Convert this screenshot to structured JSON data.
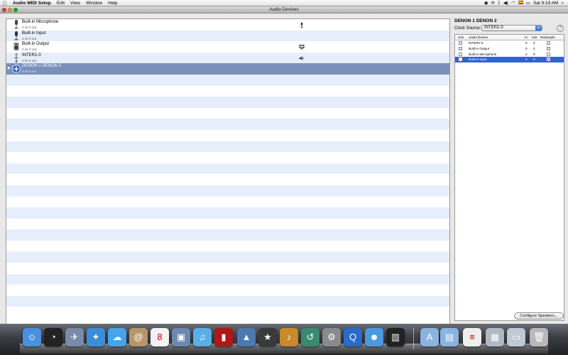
{
  "menubar": {
    "apple": "",
    "items": [
      "Audio MIDI Setup",
      "Edit",
      "View",
      "Window",
      "Help"
    ],
    "clock": "Sat 9:19 AM"
  },
  "window": {
    "title": "Audio Devices"
  },
  "devices": [
    {
      "name": "Built-in Microphone",
      "io": "2 in/ 0 out",
      "icon": "microphone-device-icon",
      "status": "microphone-status-icon"
    },
    {
      "name": "Built-in Input",
      "io": "2 in/ 0 out",
      "icon": "input-device-icon",
      "status": ""
    },
    {
      "name": "Built-in Output",
      "io": "0 in/ 2 out",
      "icon": "speaker-device-icon",
      "status": "display-status-icon"
    },
    {
      "name": "INTER1-0",
      "io": "0 in/ 2 out",
      "icon": "usb-device-icon",
      "status": "volume-status-icon"
    },
    {
      "name": "DENON 1 DENON 2",
      "io": "0 in/ 0 out",
      "icon": "aggregate-device-icon",
      "status": "",
      "selected": true
    }
  ],
  "list_footer": {
    "add": "+",
    "remove": "−",
    "gear": "⚙▾"
  },
  "panel": {
    "title": "DENON 1 DENON 2",
    "clock_label": "Clock Source:",
    "clock_value": "INTER1-0",
    "help": "?",
    "columns": {
      "use": "Use",
      "device": "Audio Device",
      "in": "In",
      "out": "Out",
      "resample": "Resample"
    },
    "rows": [
      {
        "device": "INTER1-0",
        "in": "0",
        "out": "2",
        "use": true,
        "resample": true
      },
      {
        "device": "Built-in Output",
        "in": "0",
        "out": "2",
        "use": true,
        "resample": true
      },
      {
        "device": "Built-in Microphone",
        "in": "2",
        "out": "0",
        "use": false,
        "resample": false
      },
      {
        "device": "Built-in Input",
        "in": "2",
        "out": "0",
        "use": false,
        "resample": false,
        "selected": true
      }
    ],
    "configure_button": "Configure Speakers..."
  },
  "dock": {
    "apps": [
      "finder-icon",
      "dashboard-icon",
      "mail-icon",
      "safari-icon",
      "ichat-icon",
      "address-book-icon",
      "ical-icon",
      "preview-icon",
      "itunes-icon",
      "photo-booth-icon",
      "iphoto-icon",
      "imovie-icon",
      "garageband-icon",
      "time-machine-icon",
      "system-preferences-icon",
      "quicktime-icon",
      "users-icon",
      "midi-keyboard-icon",
      "applications-folder-icon",
      "documents-folder-icon",
      "document-icon",
      "downloads-icon",
      "window-icon",
      "trash-icon"
    ]
  }
}
